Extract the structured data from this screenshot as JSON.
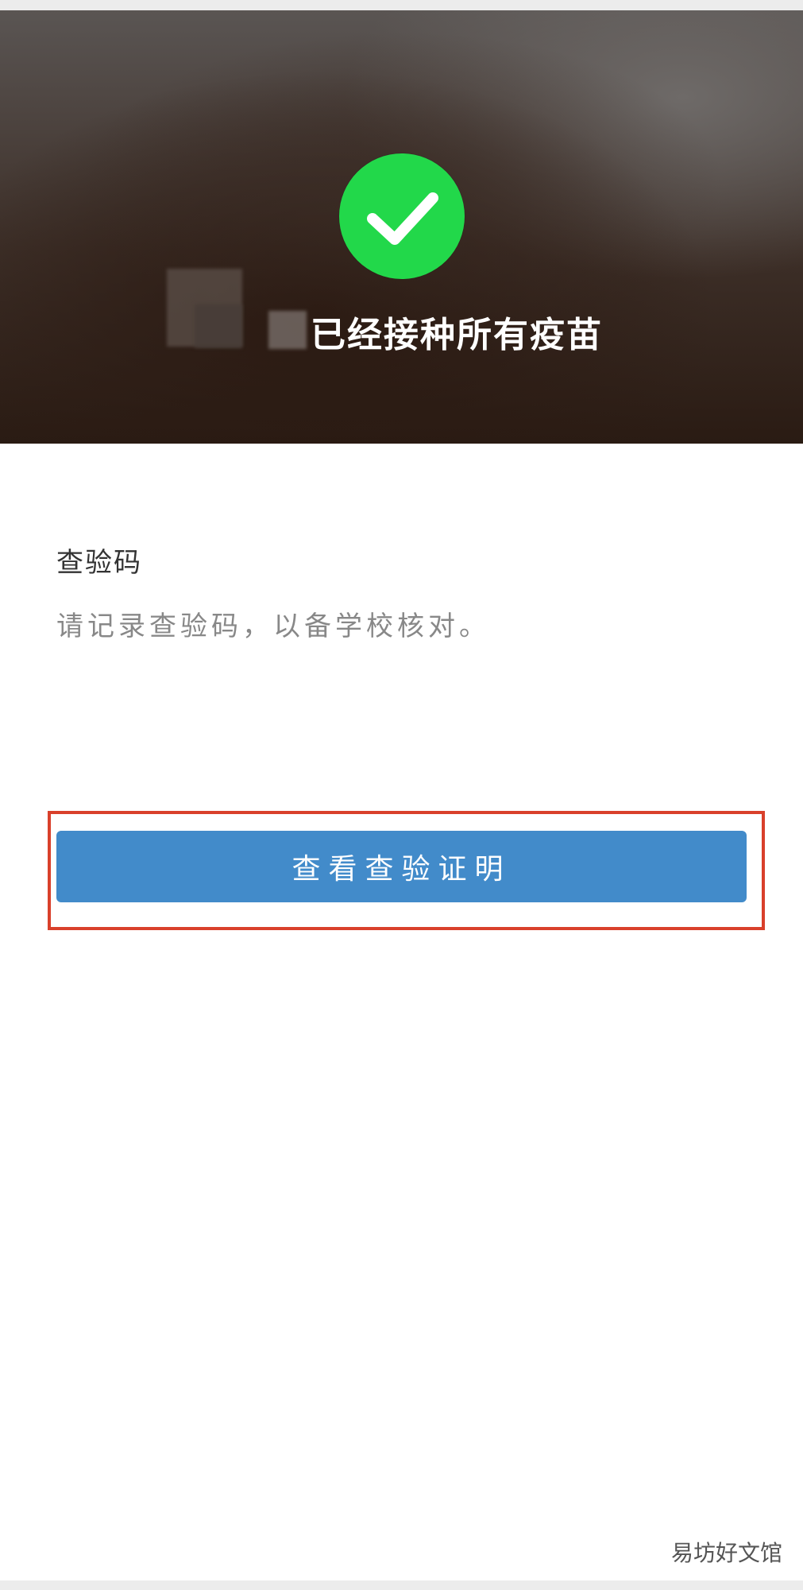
{
  "hero": {
    "status_text": "已经接种所有疫苗",
    "icon": "check-circle-icon",
    "icon_color": "#22d84a"
  },
  "section": {
    "title": "查验码",
    "description": "请记录查验码，以备学校核对。"
  },
  "actions": {
    "view_certificate_label": "查看查验证明",
    "button_color": "#428bca",
    "highlight_color": "#d9402b"
  },
  "watermark": {
    "text": "易坊好文馆"
  }
}
